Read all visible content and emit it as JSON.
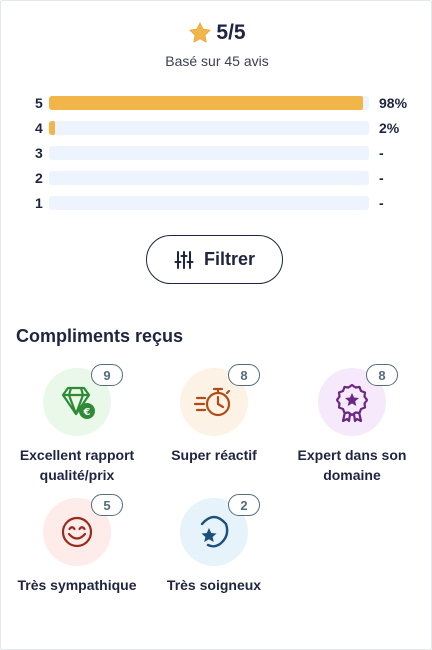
{
  "rating": {
    "score": "5/5",
    "subtitle": "Basé sur 45 avis"
  },
  "distribution": [
    {
      "label": "5",
      "fraction": 0.98,
      "pct": "98%"
    },
    {
      "label": "4",
      "fraction": 0.02,
      "pct": "2%"
    },
    {
      "label": "3",
      "fraction": 0,
      "pct": "-"
    },
    {
      "label": "2",
      "fraction": 0,
      "pct": "-"
    },
    {
      "label": "1",
      "fraction": 0,
      "pct": "-"
    }
  ],
  "filter": {
    "label": "Filtrer",
    "icon": "sliders-icon"
  },
  "compliments": {
    "title": "Compliments reçus",
    "items": [
      {
        "label": "Excellent rapport qualité/prix",
        "count": "9",
        "icon": "diamond-euro-icon",
        "bg": "#e9f8e9",
        "color": "#2f8a35"
      },
      {
        "label": "Super réactif",
        "count": "8",
        "icon": "stopwatch-icon",
        "bg": "#fdf2e6",
        "color": "#b24c17"
      },
      {
        "label": "Expert dans son domaine",
        "count": "8",
        "icon": "award-ribbon-icon",
        "bg": "#f6e9fb",
        "color": "#6a2683"
      },
      {
        "label": "Très sympathique",
        "count": "5",
        "icon": "smiley-icon",
        "bg": "#fdece9",
        "color": "#9a2a1c"
      },
      {
        "label": "Très soigneux",
        "count": "2",
        "icon": "star-swirl-icon",
        "bg": "#e6f3fb",
        "color": "#1c4f7c"
      }
    ]
  },
  "colors": {
    "accent": "#f2b54a",
    "text": "#1f2440",
    "track": "#eef4fd"
  }
}
